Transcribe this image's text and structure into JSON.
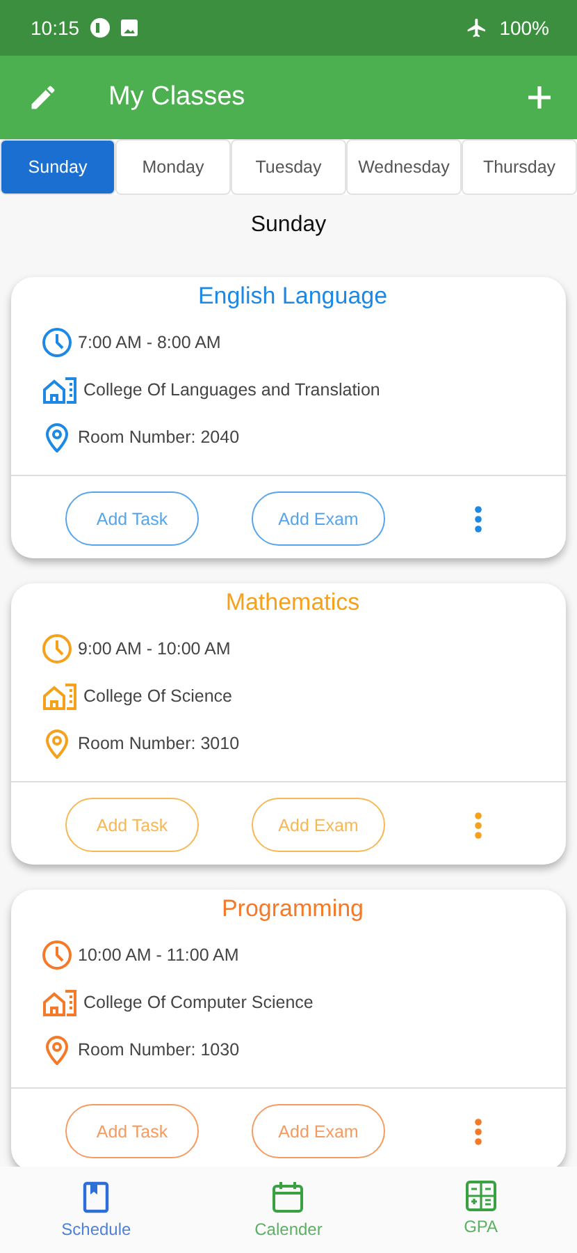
{
  "status_bar": {
    "time": "10:15",
    "battery": "100%"
  },
  "app_bar": {
    "title": "My Classes"
  },
  "tabs": [
    {
      "label": "Sunday",
      "selected": true
    },
    {
      "label": "Monday",
      "selected": false
    },
    {
      "label": "Tuesday",
      "selected": false
    },
    {
      "label": "Wednesday",
      "selected": false
    },
    {
      "label": "Thursday",
      "selected": false
    }
  ],
  "day_heading": "Sunday",
  "classes": [
    {
      "name": "English Language",
      "color": "#1e88e5",
      "time": "7:00 AM - 8:00 AM",
      "college": "College Of Languages and Translation",
      "room": "Room Number: 2040",
      "actions": [
        "Add Task",
        "Add Exam"
      ]
    },
    {
      "name": "Mathematics",
      "color": "#f5a11c",
      "time": "9:00 AM - 10:00 AM",
      "college": "College Of Science",
      "room": "Room Number: 3010",
      "actions": [
        "Add Task",
        "Add Exam"
      ]
    },
    {
      "name": "Programming",
      "color": "#f47a2a",
      "time": "10:00 AM - 11:00 AM",
      "college": "College Of Computer Science",
      "room": "Room Number: 1030",
      "actions": [
        "Add Task",
        "Add Exam"
      ]
    }
  ],
  "bottom_nav": [
    {
      "label": "Schedule",
      "kind": "book",
      "selected": true
    },
    {
      "label": "Calender",
      "kind": "calendar",
      "selected": false
    },
    {
      "label": "GPA",
      "kind": "calculator",
      "selected": false
    }
  ]
}
